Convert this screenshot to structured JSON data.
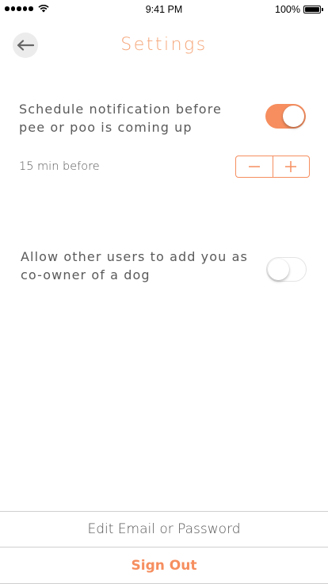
{
  "status_bar": {
    "time": "9:41 PM",
    "battery_text": "100%",
    "icons": [
      "signal-icon",
      "wifi-icon",
      "battery-icon"
    ]
  },
  "header": {
    "title": "Settings",
    "back_icon": "back-arrow-icon"
  },
  "notification_setting": {
    "label": "Schedule notification before pee or poo is coming up",
    "enabled": true,
    "lead_time": "15 min before",
    "decrement_icon": "minus-icon",
    "increment_icon": "plus-icon"
  },
  "coowner_setting": {
    "label": "Allow other users to add you as co-owner of a dog",
    "enabled": false
  },
  "actions": {
    "edit_label": "Edit Email or Password",
    "signout_label": "Sign Out"
  },
  "colors": {
    "accent": "#f68e5f",
    "title": "#f5a578",
    "text": "#5a5a5a"
  }
}
